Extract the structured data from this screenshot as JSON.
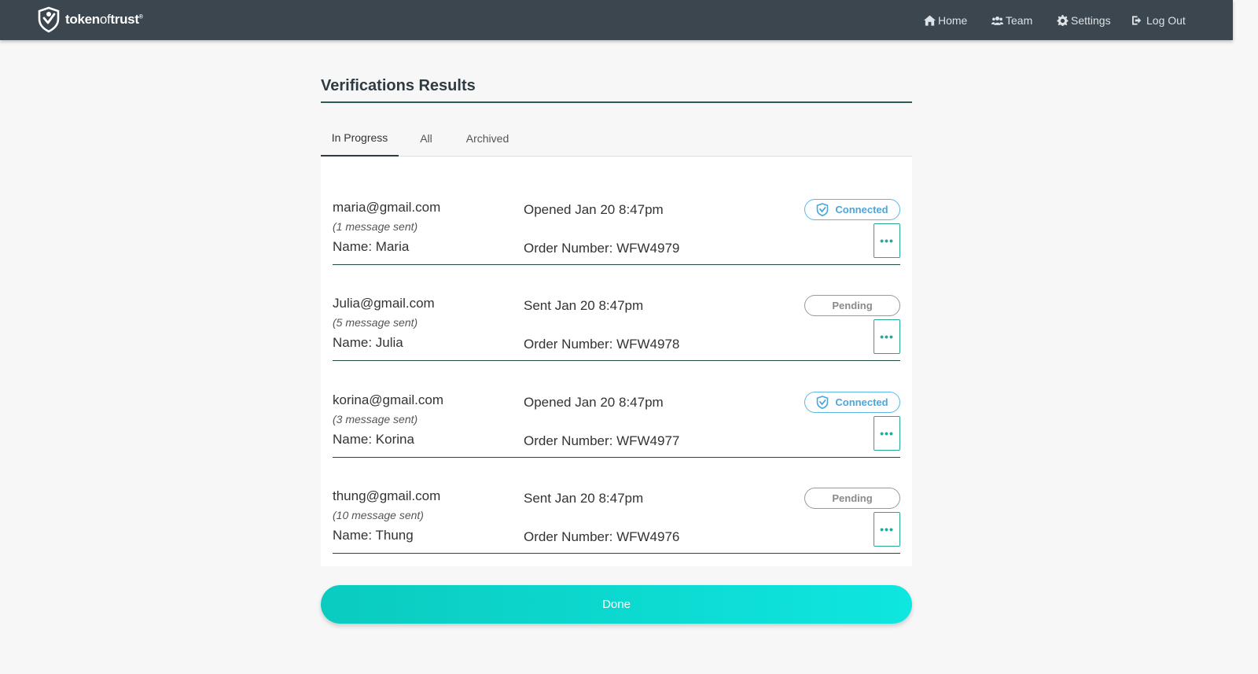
{
  "app": {
    "logo": {
      "token": "token",
      "of": "of",
      "trust": "trust",
      "mark": "®"
    }
  },
  "nav": [
    {
      "label": "Home",
      "icon": "home-icon"
    },
    {
      "label": "Team",
      "icon": "team-icon"
    },
    {
      "label": "Settings",
      "icon": "gear-icon"
    },
    {
      "label": "Log Out",
      "icon": "logout-icon"
    }
  ],
  "panel": {
    "title": "Verifications Results",
    "tabs": [
      {
        "label": "In Progress",
        "active": true
      },
      {
        "label": "All",
        "active": false
      },
      {
        "label": "Archived",
        "active": false
      }
    ]
  },
  "rows": [
    {
      "email": "maria@gmail.com",
      "messages": "(1 message sent)",
      "name": "Name: Maria",
      "status_line": "Opened Jan 20 8:47pm",
      "order": "Order Number: WFW4979",
      "badge": "Connected",
      "badge_type": "connected",
      "more": "•••"
    },
    {
      "email": "Julia@gmail.com",
      "messages": "(5 message sent)",
      "name": "Name: Julia",
      "status_line": "Sent Jan 20 8:47pm",
      "order": "Order Number: WFW4978",
      "badge": "Pending",
      "badge_type": "pending",
      "more": "•••"
    },
    {
      "email": "korina@gmail.com",
      "messages": "(3 message sent)",
      "name": "Name: Korina",
      "status_line": "Opened Jan 20 8:47pm",
      "order": "Order Number: WFW4977",
      "badge": "Connected",
      "badge_type": "connected",
      "more": "•••"
    },
    {
      "email": "thung@gmail.com",
      "messages": "(10 message sent)",
      "name": "Name: Thung",
      "status_line": "Sent Jan 20 8:47pm",
      "order": "Order Number: WFW4976",
      "badge": "Pending",
      "badge_type": "pending",
      "more": "•••"
    }
  ],
  "done_label": "Done",
  "colors": {
    "topbar": "#3b464e",
    "accent_teal": "#0bcbbf",
    "connected_blue": "#5bb8e6",
    "divider": "#1f4a44"
  }
}
